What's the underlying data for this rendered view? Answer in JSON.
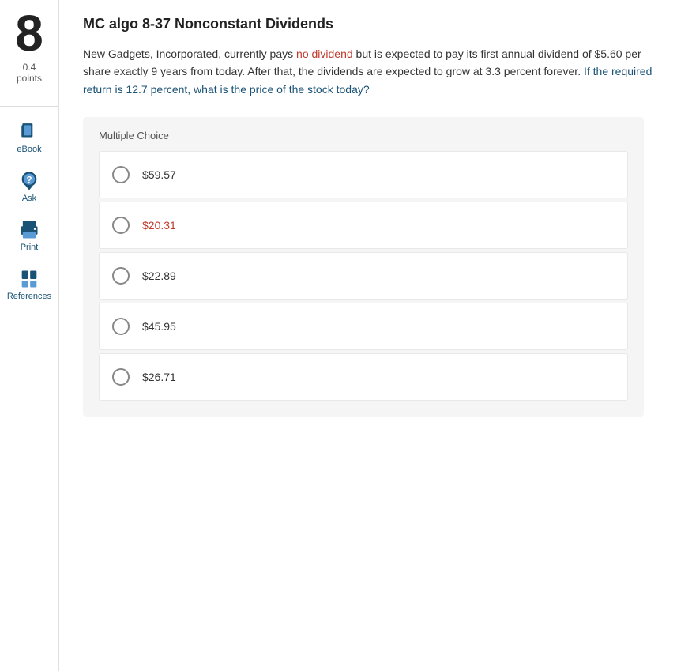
{
  "sidebar": {
    "question_number": "8",
    "points_text": "0.4",
    "points_label": "points",
    "items": [
      {
        "id": "ebook",
        "label": "eBook",
        "icon": "ebook-icon"
      },
      {
        "id": "ask",
        "label": "Ask",
        "icon": "ask-icon"
      },
      {
        "id": "print",
        "label": "Print",
        "icon": "print-icon"
      },
      {
        "id": "references",
        "label": "References",
        "icon": "references-icon"
      }
    ]
  },
  "question": {
    "title": "MC algo 8-37 Nonconstant Dividends",
    "body_part1": "New Gadgets, Incorporated, currently pays no dividend but is expected to pay its first annual dividend of $5.60 per share exactly 9 years from today. After that, the dividends are expected to grow at 3.3 percent forever.",
    "body_part2": "If the required return is 12.7 percent, what is the price of the stock today?",
    "mc_label": "Multiple Choice",
    "options": [
      {
        "id": "a",
        "text": "$59.57",
        "highlighted": false
      },
      {
        "id": "b",
        "text": "$20.31",
        "highlighted": true
      },
      {
        "id": "c",
        "text": "$22.89",
        "highlighted": false
      },
      {
        "id": "d",
        "text": "$45.95",
        "highlighted": false
      },
      {
        "id": "e",
        "text": "$26.71",
        "highlighted": false
      }
    ]
  }
}
